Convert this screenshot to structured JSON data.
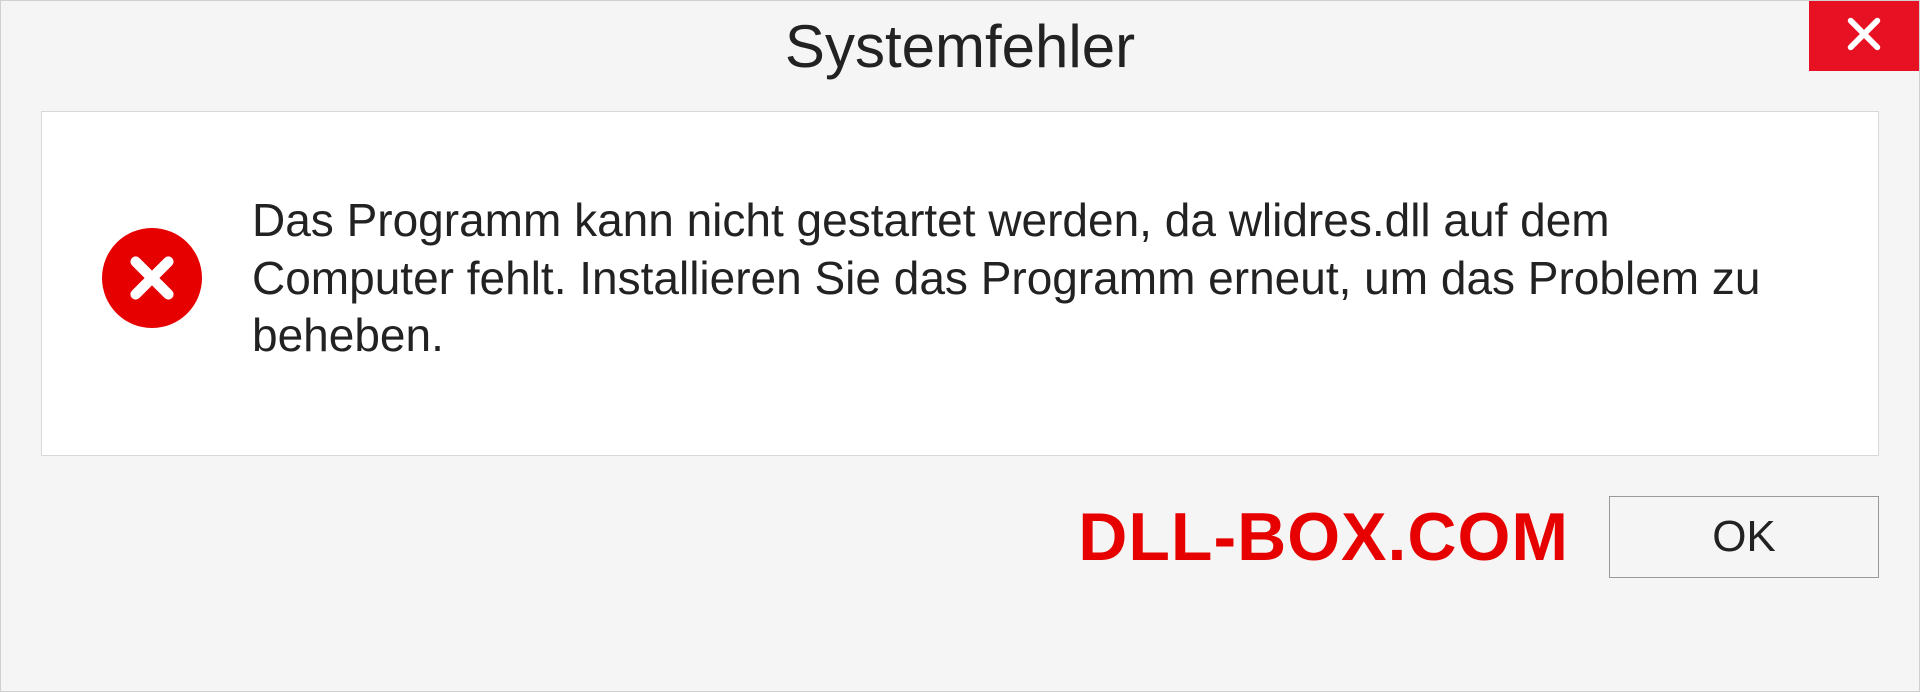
{
  "dialog": {
    "title": "Systemfehler",
    "message": "Das Programm kann nicht gestartet werden, da wlidres.dll auf dem Computer fehlt. Installieren Sie das Programm erneut, um das Problem zu beheben.",
    "ok_label": "OK"
  },
  "watermark": "DLL-BOX.COM"
}
